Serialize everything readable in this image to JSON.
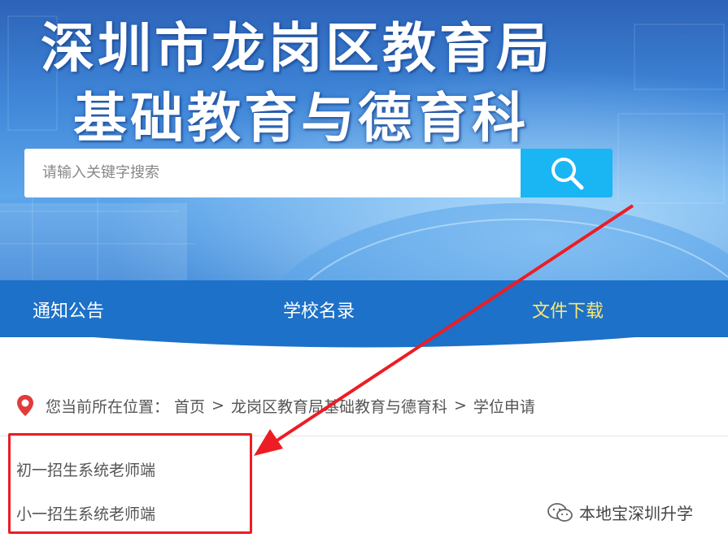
{
  "header": {
    "title_line1": "深圳市龙岗区教育局",
    "title_line2": "基础教育与德育科"
  },
  "search": {
    "placeholder": "请输入关键字搜索",
    "button_icon": "search-icon"
  },
  "nav": {
    "items": [
      {
        "label": "通知公告"
      },
      {
        "label": "学校名录"
      },
      {
        "label": "文件下载"
      }
    ],
    "active_color": "#f8e774"
  },
  "breadcrumb": {
    "prefix": "您当前所在位置：",
    "items": [
      "首页",
      "龙岗区教育局基础教育与德育科",
      "学位申请"
    ],
    "separator": ">",
    "icon": "location-pin-icon"
  },
  "links": [
    {
      "label": "初一招生系统老师端"
    },
    {
      "label": "小一招生系统老师端"
    }
  ],
  "annotation": {
    "color": "#ec1d24"
  },
  "watermark": {
    "label": "本地宝深圳升学",
    "icon": "wechat-icon"
  },
  "colors": {
    "nav_bg": "#1d71c8",
    "search_button": "#1ab5f3"
  }
}
